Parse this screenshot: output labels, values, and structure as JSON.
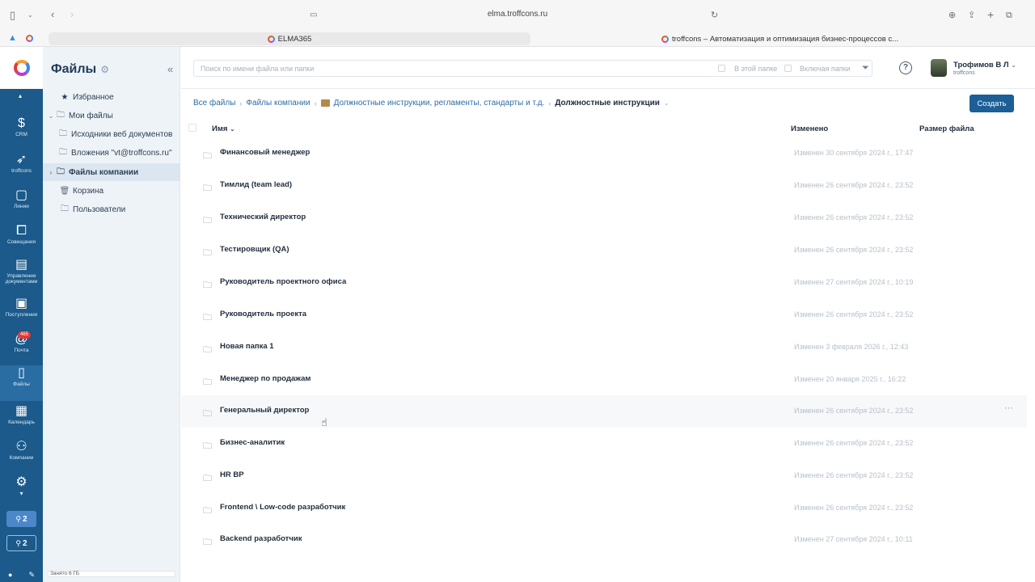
{
  "browser": {
    "url": "elma.troffcons.ru",
    "tabs": [
      {
        "label": "ELMA365"
      },
      {
        "label": "troffcons – Автоматизация и оптимизация бизнес-процессов с..."
      }
    ]
  },
  "rail": {
    "items": [
      {
        "label": "CRM",
        "icon": "dollar-icon"
      },
      {
        "label": "troffcons",
        "icon": "rocket-icon"
      },
      {
        "label": "Линии",
        "icon": "chat-icon"
      },
      {
        "label": "Совещания",
        "icon": "meeting-icon"
      },
      {
        "label": "Управление документами",
        "icon": "briefcase-icon"
      },
      {
        "label": "Поступления",
        "icon": "inbox-icon"
      },
      {
        "label": "Почта",
        "icon": "at-icon",
        "badge": "465"
      },
      {
        "label": "Файлы",
        "icon": "file-icon"
      },
      {
        "label": "Календарь",
        "icon": "calendar-icon"
      },
      {
        "label": "Компании",
        "icon": "people-icon"
      },
      {
        "label": "",
        "icon": "gear-icon"
      }
    ],
    "btn_a": "2",
    "btn_b": "2"
  },
  "sidebar": {
    "title": "Файлы",
    "items": [
      {
        "label": "Избранное"
      },
      {
        "label": "Мои файлы"
      },
      {
        "label": "Исходники веб документов"
      },
      {
        "label": "Вложения \"vt@troffcons.ru\""
      },
      {
        "label": "Файлы компании"
      },
      {
        "label": "Корзина"
      },
      {
        "label": "Пользователи"
      }
    ],
    "footer": "Занято 6 ГБ"
  },
  "header": {
    "search_placeholder": "Поиск по имени файла или папки",
    "in_folder": "В этой папке",
    "incl_folders": "Включая папки",
    "user_name": "Трофимов В Л",
    "user_org": "troffcons"
  },
  "breadcrumb": {
    "items": [
      "Все файлы",
      "Файлы компании",
      "Должностные инструкции, регламенты, стандарты и т.д."
    ],
    "current": "Должностные инструкции"
  },
  "create_label": "Создать",
  "table": {
    "col_name": "Имя",
    "col_modified": "Изменено",
    "col_size": "Размер файла",
    "rows": [
      {
        "name": "Финансовый менеджер",
        "modified": "Изменен 30 сентября 2024 г., 17:47"
      },
      {
        "name": "Тимлид (team lead)",
        "modified": "Изменен 26 сентября 2024 г., 23:52"
      },
      {
        "name": "Технический директор",
        "modified": "Изменен 26 сентября 2024 г., 23:52"
      },
      {
        "name": "Тестировщик (QA)",
        "modified": "Изменен 26 сентября 2024 г., 23:52"
      },
      {
        "name": "Руководитель проектного офиса",
        "modified": "Изменен 27 сентября 2024 г., 10:19"
      },
      {
        "name": "Руководитель проекта",
        "modified": "Изменен 26 сентября 2024 г., 23:52"
      },
      {
        "name": "Новая папка 1",
        "modified": "Изменен 3 февраля 2026 г., 12:43"
      },
      {
        "name": "Менеджер по продажам",
        "modified": "Изменен 20 января 2025 г., 16:22"
      },
      {
        "name": "Генеральный директор",
        "modified": "Изменен 26 сентября 2024 г., 23:52"
      },
      {
        "name": "Бизнес-аналитик",
        "modified": "Изменен 26 сентября 2024 г., 23:52"
      },
      {
        "name": "HR BP",
        "modified": "Изменен 26 сентября 2024 г., 23:52"
      },
      {
        "name": "Frontend \\ Low-code разработчик",
        "modified": "Изменен 26 сентября 2024 г., 23:52"
      },
      {
        "name": "Backend разработчик",
        "modified": "Изменен 27 сентября 2024 г., 10:11"
      }
    ]
  }
}
